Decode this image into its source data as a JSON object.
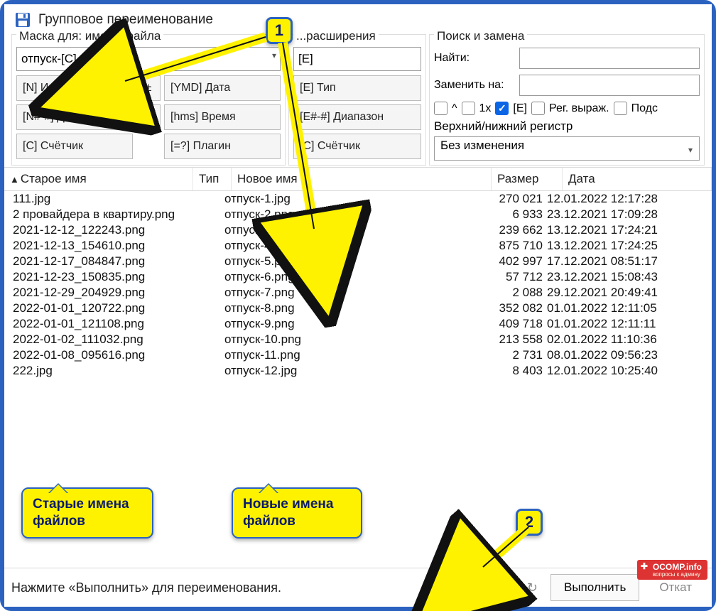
{
  "title": "Групповое переименование",
  "mask": {
    "name_legend": "Маска для: имени файла",
    "ext_legend": "...расширения",
    "name_value": "отпуск-[C]",
    "ext_value": "[E]",
    "btns_a": {
      "n": "[N]    Имя",
      "plus": "±",
      "ymd": "[YMD] Дата",
      "range": "[N#-#] Диапазон",
      "hash": "#",
      "hms": "[hms]  Время",
      "c": "[C]    Счётчик",
      "eq": "[=?]   Плагин"
    },
    "btns_b": {
      "e": "[E]     Тип",
      "erange": "[E#-#] Диапазон",
      "ecnt": "[C]    Счётчик"
    }
  },
  "search": {
    "legend": "Поиск и замена",
    "find_label": "Найти:",
    "replace_label": "Заменить на:",
    "chk_caret": "^",
    "chk_1x": "1x",
    "chk_e": "[E]",
    "chk_regex": "Рег. выраж.",
    "chk_subst": "Подс",
    "case_label": "Верхний/нижний регистр",
    "case_value": "Без изменения"
  },
  "headers": {
    "old": "Старое имя",
    "type": "Тип",
    "new": "Новое имя",
    "size": "Размер",
    "date": "Дата"
  },
  "rows": [
    {
      "old": "111.jpg",
      "new": "отпуск-1.jpg",
      "size": "270 021",
      "date": "12.01.2022 12:17:28"
    },
    {
      "old": "2 провайдера в квартиру.png",
      "new": "отпуск-2.png",
      "size": "6 933",
      "date": "23.12.2021 17:09:28"
    },
    {
      "old": "2021-12-12_122243.png",
      "new": "отпуск-3.png",
      "size": "239 662",
      "date": "13.12.2021 17:24:21"
    },
    {
      "old": "2021-12-13_154610.png",
      "new": "отпуск-4.png",
      "size": "875 710",
      "date": "13.12.2021 17:24:25"
    },
    {
      "old": "2021-12-17_084847.png",
      "new": "отпуск-5.png",
      "size": "402 997",
      "date": "17.12.2021 08:51:17"
    },
    {
      "old": "2021-12-23_150835.png",
      "new": "отпуск-6.png",
      "size": "57 712",
      "date": "23.12.2021 15:08:43"
    },
    {
      "old": "2021-12-29_204929.png",
      "new": "отпуск-7.png",
      "size": "2 088",
      "date": "29.12.2021 20:49:41"
    },
    {
      "old": "2022-01-01_120722.png",
      "new": "отпуск-8.png",
      "size": "352 082",
      "date": "01.01.2022 12:11:05"
    },
    {
      "old": "2022-01-01_121108.png",
      "new": "отпуск-9.png",
      "size": "409 718",
      "date": "01.01.2022 12:11:11"
    },
    {
      "old": "2022-01-02_111032.png",
      "new": "отпуск-10.png",
      "size": "213 558",
      "date": "02.01.2022 11:10:36"
    },
    {
      "old": "2022-01-08_095616.png",
      "new": "отпуск-11.png",
      "size": "2 731",
      "date": "08.01.2022 09:56:23"
    },
    {
      "old": "222.jpg",
      "new": "отпуск-12.jpg",
      "size": "8 403",
      "date": "12.01.2022 10:25:40"
    }
  ],
  "status": {
    "msg": "Нажмите «Выполнить» для переименования.",
    "run": "Выполнить",
    "undo": "Откат"
  },
  "annot": {
    "num1": "1",
    "num2": "2",
    "call_old": "Старые имена файлов",
    "call_new": "Новые имена файлов",
    "watermark": "OCOMP.info",
    "watermark_sub": "вопросы к админу"
  }
}
